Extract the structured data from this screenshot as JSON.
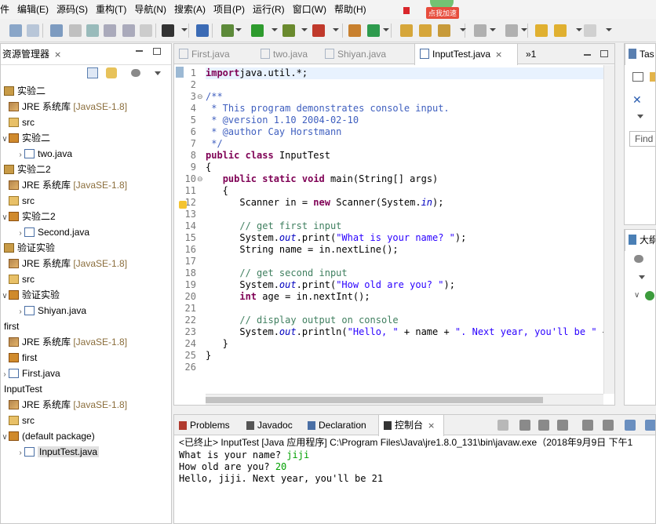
{
  "menu": [
    "件",
    "编辑(E)",
    "源码(S)",
    "重构(T)",
    "导航(N)",
    "搜索(A)",
    "项目(P)",
    "运行(R)",
    "窗口(W)",
    "帮助(H)"
  ],
  "promo_label": "点我加速",
  "explorer": {
    "title": "资源管理器",
    "close": "⨯",
    "tree": [
      {
        "indent": 0,
        "chev": "",
        "icon": "proj",
        "label": "实验二",
        "extra": ""
      },
      {
        "indent": 1,
        "chev": "",
        "icon": "jre",
        "label": "JRE 系统库 ",
        "extra": "[JavaSE-1.8]"
      },
      {
        "indent": 1,
        "chev": "",
        "icon": "src",
        "label": "src",
        "extra": ""
      },
      {
        "indent": 1,
        "chev": "∨",
        "icon": "pkg",
        "label": "实验二",
        "extra": ""
      },
      {
        "indent": 2,
        "chev": "›",
        "icon": "java",
        "label": "two.java",
        "extra": ""
      },
      {
        "indent": 0,
        "chev": "",
        "icon": "proj",
        "label": "实验二2",
        "extra": ""
      },
      {
        "indent": 1,
        "chev": "",
        "icon": "jre",
        "label": "JRE 系统库 ",
        "extra": "[JavaSE-1.8]"
      },
      {
        "indent": 1,
        "chev": "",
        "icon": "src",
        "label": "src",
        "extra": ""
      },
      {
        "indent": 1,
        "chev": "∨",
        "icon": "pkg",
        "label": "实验二2",
        "extra": ""
      },
      {
        "indent": 2,
        "chev": "›",
        "icon": "java",
        "label": "Second.java",
        "extra": ""
      },
      {
        "indent": 0,
        "chev": "",
        "icon": "proj",
        "label": "验证实验",
        "extra": ""
      },
      {
        "indent": 1,
        "chev": "",
        "icon": "jre",
        "label": "JRE 系统库 ",
        "extra": "[JavaSE-1.8]"
      },
      {
        "indent": 1,
        "chev": "",
        "icon": "src",
        "label": "src",
        "extra": ""
      },
      {
        "indent": 1,
        "chev": "∨",
        "icon": "pkg",
        "label": "验证实验",
        "extra": ""
      },
      {
        "indent": 2,
        "chev": "›",
        "icon": "java",
        "label": "Shiyan.java",
        "extra": ""
      },
      {
        "indent": 0,
        "chev": "",
        "icon": "none",
        "label": "first",
        "extra": ""
      },
      {
        "indent": 1,
        "chev": "",
        "icon": "jre",
        "label": "JRE 系统库 ",
        "extra": "[JavaSE-1.8]"
      },
      {
        "indent": 1,
        "chev": "",
        "icon": "pkg",
        "label": "first",
        "extra": ""
      },
      {
        "indent": 1,
        "chev": "›",
        "icon": "java",
        "label": "First.java",
        "extra": ""
      },
      {
        "indent": 0,
        "chev": "",
        "icon": "none",
        "label": "InputTest",
        "extra": ""
      },
      {
        "indent": 1,
        "chev": "",
        "icon": "jre",
        "label": "JRE 系统库 ",
        "extra": "[JavaSE-1.8]"
      },
      {
        "indent": 1,
        "chev": "",
        "icon": "src",
        "label": "src",
        "extra": ""
      },
      {
        "indent": 1,
        "chev": "∨",
        "icon": "pkg",
        "label": "(default package)",
        "extra": ""
      },
      {
        "indent": 2,
        "chev": "›",
        "icon": "java",
        "label": "InputTest.java",
        "extra": ""
      }
    ]
  },
  "editor": {
    "tabs": [
      {
        "label": "First.java",
        "active": false
      },
      {
        "label": "two.java",
        "active": false
      },
      {
        "label": "Shiyan.java",
        "active": false
      },
      {
        "label": "InputTest.java",
        "active": true
      }
    ],
    "overflow_label": "»1",
    "line_numbers": [
      "1",
      "2",
      "3",
      "4",
      "5",
      "6",
      "7",
      "8",
      "9",
      "10",
      "11",
      "12",
      "13",
      "14",
      "15",
      "16",
      "17",
      "18",
      "19",
      "20",
      "21",
      "22",
      "23",
      "24",
      "25",
      "26"
    ],
    "code_lines": [
      [
        [
          "kw",
          "import"
        ],
        [
          "",
          "java.util.*;"
        ]
      ],
      [],
      [
        [
          "jd",
          "/**"
        ]
      ],
      [
        [
          "jd",
          " * This program demonstrates console input."
        ]
      ],
      [
        [
          "jd",
          " * @version 1.10 2004-02-10"
        ]
      ],
      [
        [
          "jd",
          " * @author Cay Horstmann"
        ]
      ],
      [
        [
          "jd",
          " */"
        ]
      ],
      [
        [
          "kw",
          "public"
        ],
        [
          "",
          " "
        ],
        [
          "kw",
          "class"
        ],
        [
          "",
          " InputTest"
        ]
      ],
      [
        [
          "",
          "{"
        ]
      ],
      [
        [
          "",
          "   "
        ],
        [
          "kw",
          "public"
        ],
        [
          "",
          " "
        ],
        [
          "kw",
          "static"
        ],
        [
          "",
          " "
        ],
        [
          "kw",
          "void"
        ],
        [
          "",
          " main(String[] args)"
        ]
      ],
      [
        [
          "",
          "   {"
        ]
      ],
      [
        [
          "",
          "      Scanner in = "
        ],
        [
          "kw",
          "new"
        ],
        [
          "",
          " Scanner(System."
        ],
        [
          "fld",
          "in"
        ],
        [
          "",
          ");"
        ]
      ],
      [],
      [
        [
          "",
          "      "
        ],
        [
          "cm",
          "// get first input"
        ]
      ],
      [
        [
          "",
          "      System."
        ],
        [
          "fld",
          "out"
        ],
        [
          "",
          ".print("
        ],
        [
          "str",
          "\"What is your name? \""
        ],
        [
          "",
          ");"
        ]
      ],
      [
        [
          "",
          "      String name = in.nextLine();"
        ]
      ],
      [],
      [
        [
          "",
          "      "
        ],
        [
          "cm",
          "// get second input"
        ]
      ],
      [
        [
          "",
          "      System."
        ],
        [
          "fld",
          "out"
        ],
        [
          "",
          ".print("
        ],
        [
          "str",
          "\"How old are you? \""
        ],
        [
          "",
          ");"
        ]
      ],
      [
        [
          "",
          "      "
        ],
        [
          "kw",
          "int"
        ],
        [
          "",
          " age = in.nextInt();"
        ]
      ],
      [],
      [
        [
          "",
          "      "
        ],
        [
          "cm",
          "// display output on console"
        ]
      ],
      [
        [
          "",
          "      System."
        ],
        [
          "fld",
          "out"
        ],
        [
          "",
          ".println("
        ],
        [
          "str",
          "\"Hello, \""
        ],
        [
          "",
          " + name + "
        ],
        [
          "str",
          "\". Next year, you'll be \""
        ],
        [
          "",
          " +"
        ]
      ],
      [
        [
          "",
          "   }"
        ]
      ],
      [
        [
          "",
          "}"
        ]
      ],
      []
    ]
  },
  "right_panel": {
    "tasks_label": "Tas",
    "find_label": "Find",
    "outline_label": "大纲"
  },
  "console": {
    "tabs": [
      {
        "label": "Problems",
        "active": false
      },
      {
        "label": "Javadoc",
        "active": false
      },
      {
        "label": "Declaration",
        "active": false
      },
      {
        "label": "控制台",
        "active": true
      }
    ],
    "terminated": "<已终止> InputTest [Java 应用程序] C:\\Program Files\\Java\\jre1.8.0_131\\bin\\javaw.exe（2018年9月9日 下午1",
    "lines": [
      {
        "prompt": "What is your name? ",
        "input": "jiji"
      },
      {
        "prompt": "How old are you? ",
        "input": "20"
      },
      {
        "prompt": "Hello, jiji. Next year, you'll be 21",
        "input": ""
      }
    ]
  }
}
